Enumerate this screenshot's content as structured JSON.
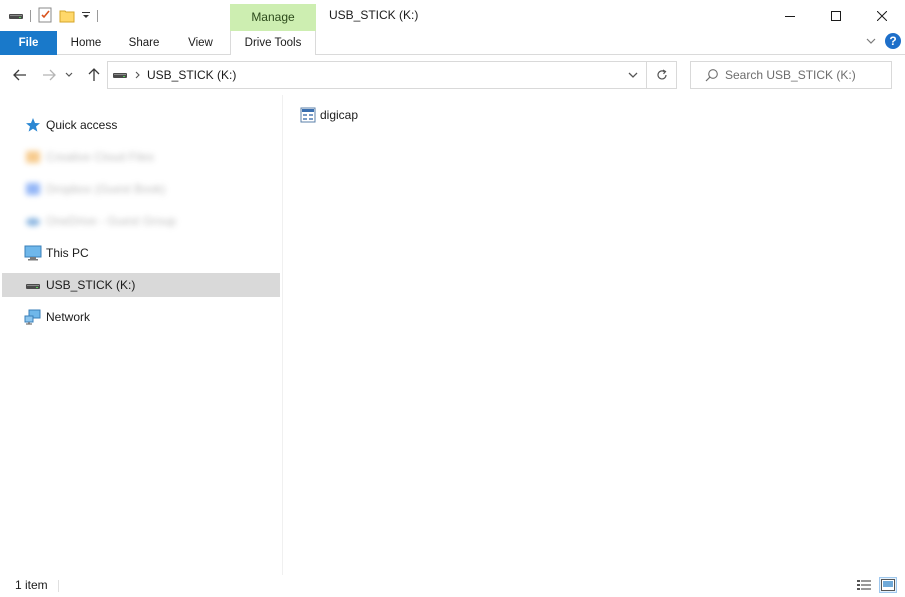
{
  "titlebar": {
    "contextual_tab": "Manage",
    "window_title": "USB_STICK (K:)",
    "buttons": [
      "minimize-icon",
      "maximize-icon",
      "close-icon"
    ]
  },
  "ribbon": {
    "tabs": {
      "file": "File",
      "home": "Home",
      "share": "Share",
      "view": "View",
      "drive_tools": "Drive Tools"
    },
    "help_label": "?"
  },
  "address_bar": {
    "crumbs": [
      "USB_STICK (K:)"
    ],
    "search_placeholder": "Search USB_STICK (K:)"
  },
  "nav_pane": {
    "items": [
      {
        "label": "Quick access",
        "icon": "star-icon"
      },
      {
        "label": "Creative Cloud Files",
        "icon": "creative-cloud-icon",
        "blurred": true
      },
      {
        "label": "Dropbox (Guest Book)",
        "icon": "dropbox-icon",
        "blurred": true
      },
      {
        "label": "OneDrive - Guest Group",
        "icon": "onedrive-icon",
        "blurred": true
      },
      {
        "label": "This PC",
        "icon": "computer-icon"
      },
      {
        "label": "USB_STICK (K:)",
        "icon": "drive-icon",
        "selected": true
      },
      {
        "label": "Network",
        "icon": "network-icon"
      }
    ]
  },
  "content": {
    "files": [
      {
        "name": "digicap",
        "icon": "data-file-icon"
      }
    ]
  },
  "statusbar": {
    "item_count": "1 item"
  },
  "colors": {
    "file_tab": "#1979ca",
    "manage_tab": "#cdeeb1",
    "selection": "#d9d9d9",
    "help": "#1e6fc9"
  }
}
